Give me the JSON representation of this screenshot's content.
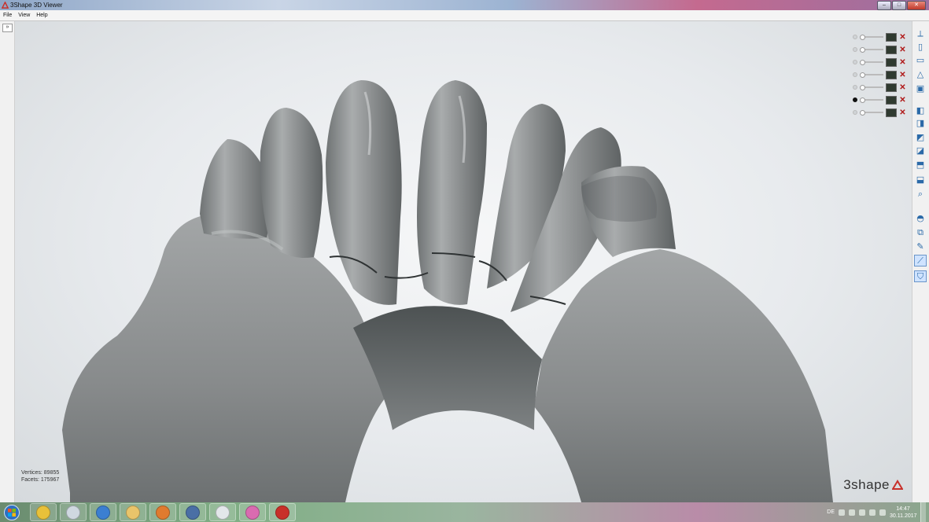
{
  "window": {
    "title": "3Shape 3D Viewer",
    "controls": {
      "minimize": "–",
      "maximize": "□",
      "close": "✕"
    }
  },
  "menu": {
    "items": [
      "File",
      "View",
      "Help"
    ]
  },
  "left_panel": {
    "collapse_icon": "double-chevron-down-icon"
  },
  "viewport": {
    "stats": {
      "vertices": "Vertices: 89855",
      "facets": "Facets: 175967"
    },
    "brand": "3shape"
  },
  "layers": [
    {
      "selected": false
    },
    {
      "selected": false
    },
    {
      "selected": false
    },
    {
      "selected": false
    },
    {
      "selected": false
    },
    {
      "selected": true
    },
    {
      "selected": false
    }
  ],
  "right_toolbar": {
    "tools": [
      "axes-icon",
      "page-icon",
      "monitor-icon",
      "measure-icon",
      "cube-icon",
      "view-front-icon",
      "view-back-icon",
      "view-left-icon",
      "view-right-icon",
      "view-top-icon",
      "view-bottom-icon",
      "zoom-fit-icon",
      "cross-section-icon",
      "overlay-icon",
      "pen-icon",
      "line-tool-icon",
      "tooth-icon"
    ],
    "active": [
      "line-tool-icon",
      "tooth-icon"
    ]
  },
  "taskbar": {
    "apps": [
      "chrome-icon",
      "virtualbox-icon",
      "internet-explorer-icon",
      "file-explorer-icon",
      "media-player-icon",
      "network-icon",
      "3shape-dental-icon",
      "itunes-icon",
      "3shape-viewer-icon"
    ],
    "language": "DE",
    "time": "14:47",
    "date": "30.11.2017"
  },
  "colors": {
    "accent": "#c8302a",
    "model": "#8a8d8e"
  }
}
